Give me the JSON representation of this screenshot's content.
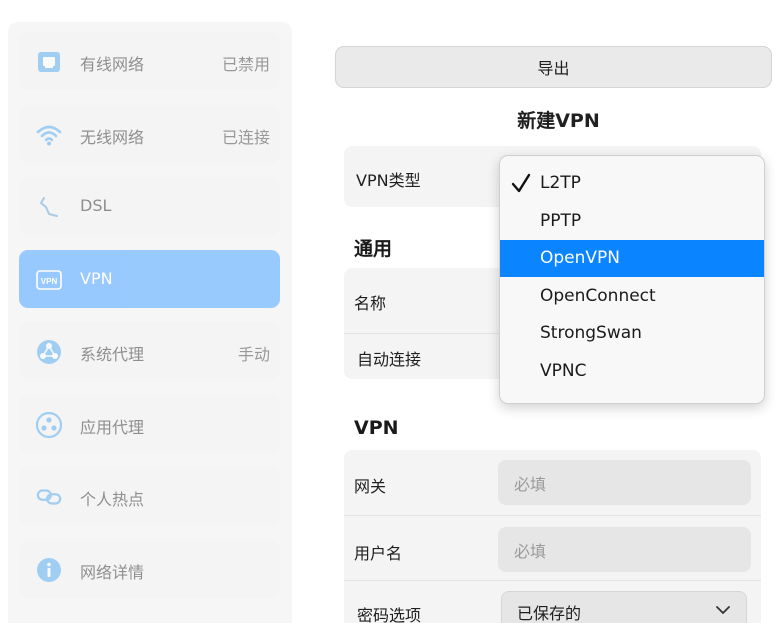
{
  "sidebar": {
    "items": [
      {
        "label": "有线网络",
        "status": "已禁用",
        "icon": "ethernet-icon"
      },
      {
        "label": "无线网络",
        "status": "已连接",
        "icon": "wifi-icon"
      },
      {
        "label": "DSL",
        "status": "",
        "icon": "dsl-icon"
      },
      {
        "label": "VPN",
        "status": "",
        "icon": "vpn-icon",
        "icon_text": "VPN",
        "selected": true
      },
      {
        "label": "系统代理",
        "status": "手动",
        "icon": "system-proxy-icon"
      },
      {
        "label": "应用代理",
        "status": "",
        "icon": "app-proxy-icon"
      },
      {
        "label": "个人热点",
        "status": "",
        "icon": "hotspot-icon"
      },
      {
        "label": "网络详情",
        "status": "",
        "icon": "info-icon"
      }
    ]
  },
  "main": {
    "export_label": "导出",
    "title": "新建VPN",
    "vpn_type_label": "VPN类型",
    "general_section": "通用",
    "name_label": "名称",
    "autoconnect_label": "自动连接",
    "vpn_section": "VPN",
    "gateway_label": "网关",
    "gateway_placeholder": "必填",
    "username_label": "用户名",
    "username_placeholder": "必填",
    "password_option_label": "密码选项",
    "password_option_value": "已保存的"
  },
  "dropdown": {
    "options": [
      "L2TP",
      "PPTP",
      "OpenVPN",
      "OpenConnect",
      "StrongSwan",
      "VPNC"
    ],
    "checked": "L2TP",
    "highlighted": "OpenVPN"
  },
  "colors": {
    "accent": "#0a84ff",
    "selected_nav": "#8ec5ff",
    "icon_blue": "#5aaef0"
  }
}
